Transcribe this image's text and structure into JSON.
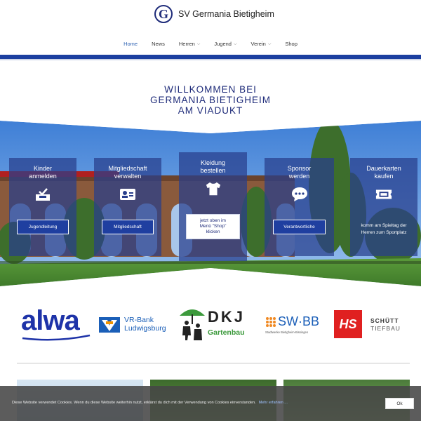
{
  "header": {
    "logo_letter": "G",
    "site_name": "SV Germania Bietigheim"
  },
  "nav": {
    "items": [
      {
        "label": "Home",
        "active": true,
        "dropdown": false
      },
      {
        "label": "News",
        "active": false,
        "dropdown": false
      },
      {
        "label": "Herren",
        "active": false,
        "dropdown": true
      },
      {
        "label": "Jugend",
        "active": false,
        "dropdown": true
      },
      {
        "label": "Verein",
        "active": false,
        "dropdown": true
      },
      {
        "label": "Shop",
        "active": false,
        "dropdown": false
      }
    ],
    "chevron": "⌄"
  },
  "hero": {
    "title_line1": "WILLKOMMEN BEI",
    "title_line2": "GERMANIA BIETIGHEIM",
    "title_line3": "AM VIADUKT"
  },
  "cards": [
    {
      "title_1": "Kinder",
      "title_2": "anmelden",
      "icon": "inbox-check-icon",
      "button": "Jugendleitung"
    },
    {
      "title_1": "Mitgliedschaft",
      "title_2": "verwalten",
      "icon": "id-card-icon",
      "button": "Mitgliedschaft"
    },
    {
      "title_1": "Kleidung",
      "title_2": "bestellen",
      "icon": "tshirt-icon",
      "button_1": "jetzt oben im",
      "button_2": "Menü \"Shop\"",
      "button_3": "klicken"
    },
    {
      "title_1": "Sponsor",
      "title_2": "werden",
      "icon": "chat-bubble-icon",
      "button": "Verantwortliche"
    },
    {
      "title_1": "Dauerkarten",
      "title_2": "kaufen",
      "icon": "ticket-icon",
      "note_1": "komm am Spieltag der",
      "note_2": "Herren zum Sportplatz"
    }
  ],
  "sponsors": {
    "alwa": "alwa",
    "vrbank_1": "VR-Bank",
    "vrbank_2": "Ludwigsburg",
    "dkj_1": "DKJ",
    "dkj_2": "Gartenbau",
    "swbb_1": "SW·BB",
    "swbb_2": "Stadtwerke Bietigheim-Bissingen",
    "schuett_logo": "HS",
    "schuett_1": "SCHÜTT",
    "schuett_2": "TIEFBAU"
  },
  "cookie": {
    "text": "Diese Website verwendet Cookies. Wenn du diese Website weiterhin nutzt, erklärst du dich mit der Verwendung von Cookies einverstanden.",
    "link": "Mehr erfahren ...",
    "ok": "Ok"
  },
  "colors": {
    "brand_blue": "#1c3fa0",
    "title_blue": "#1f2c7a",
    "nav_active": "#2f63b3"
  }
}
